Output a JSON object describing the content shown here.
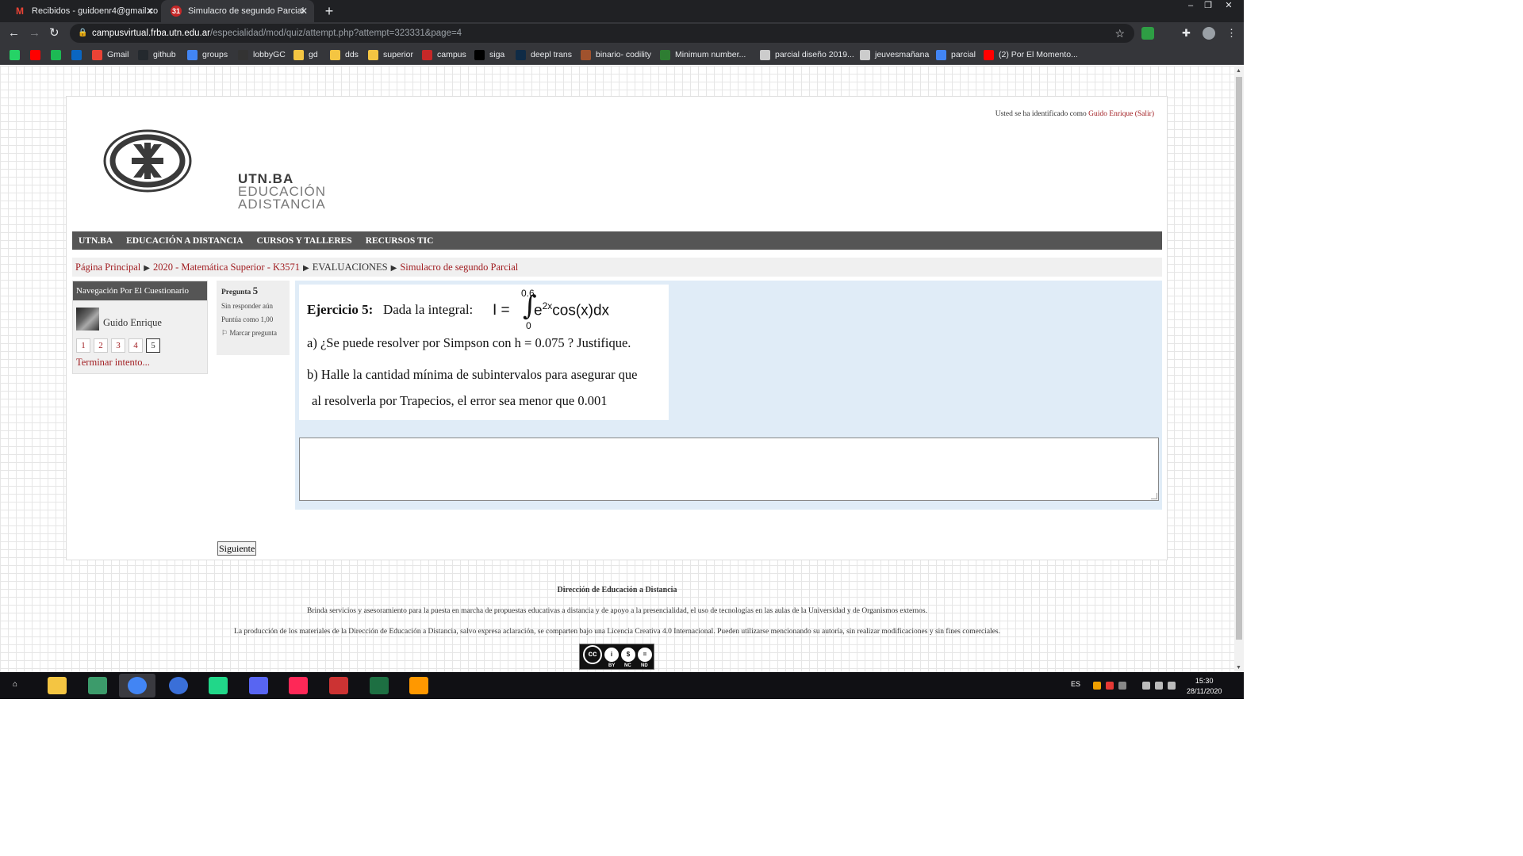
{
  "browser": {
    "tabs": [
      {
        "title": "Recibidos - guidoenr4@gmail.co",
        "active": false,
        "favicon": "gmail-icon"
      },
      {
        "title": "Simulacro de segundo Parcial",
        "active": true,
        "favicon": "utn-moodle-icon"
      }
    ],
    "url_host": "campusvirtual.frba.utn.edu.ar",
    "url_path": "/especialidad/mod/quiz/attempt.php?attempt=323331&page=4",
    "bookmarks": [
      {
        "label": "",
        "icon": "whatsapp-icon",
        "color": "#25d366"
      },
      {
        "label": "",
        "icon": "youtube-icon",
        "color": "#ff0000"
      },
      {
        "label": "",
        "icon": "spotify-icon",
        "color": "#1db954"
      },
      {
        "label": "",
        "icon": "linkedin-icon",
        "color": "#0a66c2"
      },
      {
        "label": "Gmail",
        "icon": "gmail-icon",
        "color": "#ea4335"
      },
      {
        "label": "github",
        "icon": "github-icon",
        "color": "#24292e"
      },
      {
        "label": "groups",
        "icon": "groups-icon",
        "color": "#4285f4"
      },
      {
        "label": "lobbyGC",
        "icon": "lobby-icon",
        "color": "#333"
      },
      {
        "label": "gd",
        "icon": "folder-icon",
        "color": "#f4c542"
      },
      {
        "label": "dds",
        "icon": "folder-icon",
        "color": "#f4c542"
      },
      {
        "label": "superior",
        "icon": "folder-icon",
        "color": "#f4c542"
      },
      {
        "label": "campus",
        "icon": "utn-moodle-icon",
        "color": "#c62828"
      },
      {
        "label": "siga",
        "icon": "siga-icon",
        "color": "#000"
      },
      {
        "label": "deepl trans",
        "icon": "deepl-icon",
        "color": "#0f2b46"
      },
      {
        "label": "binario- codility",
        "icon": "codility-icon",
        "color": "#a0522d"
      },
      {
        "label": "Minimum number...",
        "icon": "link-icon",
        "color": "#2e7d32"
      },
      {
        "label": "parcial diseño 2019...",
        "icon": "loading-icon",
        "color": "#ccc"
      },
      {
        "label": "jeuvesmañana",
        "icon": "loading-icon",
        "color": "#ccc"
      },
      {
        "label": "parcial",
        "icon": "docs-icon",
        "color": "#4285f4"
      },
      {
        "label": "(2) Por El Momento...",
        "icon": "youtube-icon",
        "color": "#ff0000"
      }
    ]
  },
  "page": {
    "login_prefix": "Usted se ha identificado como",
    "login_user": "Guido Enrique",
    "login_logout": "(Salir)",
    "logo": {
      "line1": "UTN.BA",
      "line2": "EDUCACIÓN",
      "line3": "ADISTANCIA"
    },
    "nav": [
      "UTN.BA",
      "EDUCACIÓN A DISTANCIA",
      "CURSOS Y TALLERES",
      "RECURSOS TIC"
    ],
    "breadcrumb": {
      "home": "Página Principal",
      "course": "2020 - Matemática Superior - K3571",
      "section": "EVALUACIONES",
      "current": "Simulacro de segundo Parcial"
    },
    "quiz_nav": {
      "title": "Navegación Por El Cuestionario",
      "user": "Guido Enrique",
      "pages": [
        "1",
        "2",
        "3",
        "4",
        "5"
      ],
      "current_page": "5",
      "finish": "Terminar intento..."
    },
    "question_info": {
      "label": "Pregunta",
      "number": "5",
      "status": "Sin responder aún",
      "points": "Puntúa como 1,00",
      "flag": "Marcar pregunta"
    },
    "question": {
      "heading": "Ejercicio 5:",
      "intro": "Dada la integral:",
      "lhs": "I =",
      "upper_limit": "0.6",
      "lower_limit": "0",
      "integrand_base": "e",
      "integrand_exp": "2x",
      "integrand_rest": "cos(x)dx",
      "part_a": "a) ¿Se puede resolver por Simpson con h = 0.075 ? Justifique.",
      "part_b1": "b) Halle la cantidad mínima de subintervalos para asegurar que",
      "part_b2": "al resolverla por Trapecios, el error sea menor que 0.001"
    },
    "answer_value": "",
    "next_button": "Siguiente"
  },
  "footer": {
    "title": "Dirección de Educación a Distancia",
    "line1": "Brinda servicios y asesoramiento para la puesta en marcha de propuestas educativas a distancia y de apoyo a la presencialidad, el uso de tecnologías en las aulas de la Universidad y de Organismos externos.",
    "line2": "La producción de los materiales de la Dirección de Educación a Distancia, salvo expresa aclaración, se comparten bajo una Licencia Creativa 4.0 Internacional. Pueden utilizarse mencionando su autoría, sin realizar modificaciones y sin fines comerciales.",
    "license_labels": [
      "BY",
      "NC",
      "ND"
    ]
  },
  "taskbar": {
    "apps": [
      "file-explorer-icon",
      "git-kraken-icon",
      "chrome-icon",
      "app-circle-icon",
      "pycharm-icon",
      "discord-icon",
      "intellij-icon",
      "ccleaner-icon",
      "excel-icon",
      "sublime-icon"
    ],
    "language": "ES",
    "time": "15:30",
    "date": "28/11/2020"
  }
}
